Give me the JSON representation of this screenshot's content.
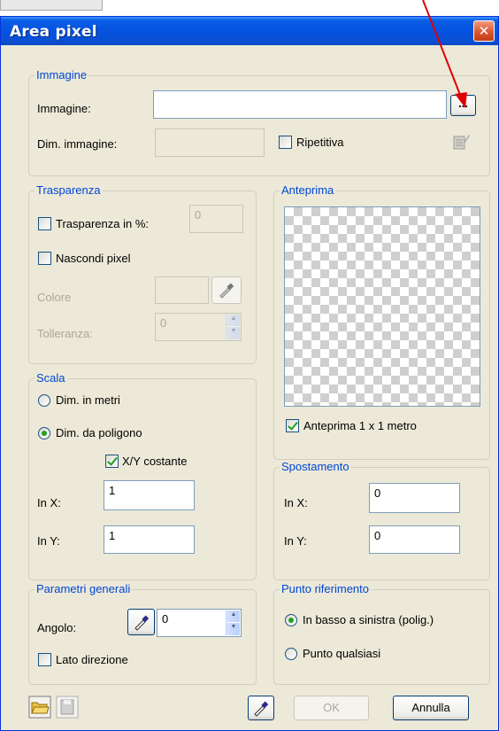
{
  "dialog": {
    "title": "Area pixel",
    "close_glyph": "✕"
  },
  "immagine": {
    "legend": "Immagine",
    "image_label": "Immagine:",
    "image_value": "",
    "browse_label": "...",
    "size_label": "Dim. immagine:",
    "size_value": "",
    "repeat_label": "Ripetitiva",
    "repeat_checked": false
  },
  "trasparenza": {
    "legend": "Trasparenza",
    "percent_label": "Trasparenza in %:",
    "percent_checked": false,
    "percent_value": "0",
    "hide_label": "Nascondi pixel",
    "hide_checked": false,
    "color_label": "Colore",
    "tolerance_label": "Tolleranza:",
    "tolerance_value": "0"
  },
  "anteprima": {
    "legend": "Anteprima",
    "check_label": "Anteprima 1 x 1 metro",
    "check_checked": true
  },
  "scala": {
    "legend": "Scala",
    "radio_meters": "Dim. in metri",
    "radio_polygon": "Dim. da poligono",
    "selected": "polygon",
    "xy_label": "X/Y costante",
    "xy_checked": true,
    "x_label": "In X:",
    "x_value": "1",
    "y_label": "In Y:",
    "y_value": "1"
  },
  "spostamento": {
    "legend": "Spostamento",
    "x_label": "In X:",
    "x_value": "0",
    "y_label": "In Y:",
    "y_value": "0"
  },
  "parametri": {
    "legend": "Parametri generali",
    "angle_label": "Angolo:",
    "angle_value": "0",
    "direction_label": "Lato direzione",
    "direction_checked": false
  },
  "punto": {
    "legend": "Punto riferimento",
    "radio_bottom_left": "In basso a sinistra (polig.)",
    "radio_any": "Punto qualsiasi",
    "selected": "bottom_left"
  },
  "footer": {
    "ok_label": "OK",
    "cancel_label": "Annulla"
  },
  "colors": {
    "accent": "#0046d5",
    "title_bar": "#0553e1",
    "arrow": "#e00000"
  }
}
